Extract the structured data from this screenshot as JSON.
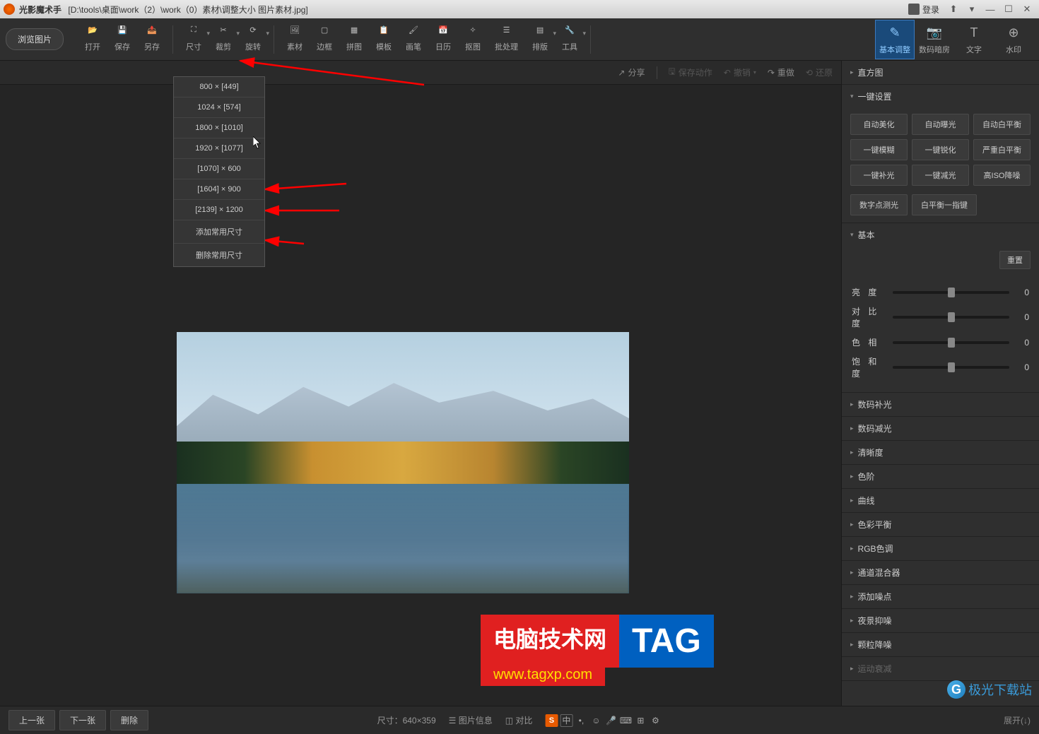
{
  "titlebar": {
    "app_name": "光影魔术手",
    "file_path": "[D:\\tools\\桌面\\work（2）\\work（0）素材\\调整大小 图片素材.jpg]",
    "login": "登录"
  },
  "toolbar": {
    "browse": "浏览图片",
    "items": [
      {
        "label": "打开",
        "icon": "open"
      },
      {
        "label": "保存",
        "icon": "save"
      },
      {
        "label": "另存",
        "icon": "saveas"
      },
      {
        "label": "尺寸",
        "icon": "size",
        "arrow": true
      },
      {
        "label": "裁剪",
        "icon": "crop",
        "arrow": true
      },
      {
        "label": "旋转",
        "icon": "rotate",
        "arrow": true
      },
      {
        "label": "素材",
        "icon": "material"
      },
      {
        "label": "边框",
        "icon": "border"
      },
      {
        "label": "拼图",
        "icon": "collage"
      },
      {
        "label": "模板",
        "icon": "template"
      },
      {
        "label": "画笔",
        "icon": "brush"
      },
      {
        "label": "日历",
        "icon": "calendar"
      },
      {
        "label": "抠图",
        "icon": "cutout"
      },
      {
        "label": "批处理",
        "icon": "batch"
      },
      {
        "label": "排版",
        "icon": "layout",
        "arrow": true
      },
      {
        "label": "工具",
        "icon": "tools",
        "arrow": true
      }
    ]
  },
  "right_tabs": [
    {
      "label": "基本调整",
      "active": true
    },
    {
      "label": "数码暗房",
      "active": false
    },
    {
      "label": "文字",
      "active": false
    },
    {
      "label": "水印",
      "active": false
    }
  ],
  "action_bar": {
    "share": "分享",
    "save_action": "保存动作",
    "undo": "撤销",
    "redo": "重做",
    "restore": "还原"
  },
  "dropdown": {
    "items": [
      "800 × [449]",
      "1024 × [574]",
      "1800 × [1010]",
      "1920 × [1077]",
      "[1070] × 600",
      "[1604] × 900",
      "[2139] × 1200",
      "添加常用尺寸",
      "删除常用尺寸"
    ]
  },
  "right_panel": {
    "sections": {
      "histogram": "直方图",
      "oneclick": "一键设置",
      "basic": "基本",
      "digital_fill": "数码补光",
      "digital_dim": "数码减光",
      "clarity": "清晰度",
      "levels": "色阶",
      "curves": "曲线",
      "color_balance": "色彩平衡",
      "rgb": "RGB色调",
      "channel_mix": "通道混合器",
      "add_noise": "添加噪点",
      "night_suppress": "夜景抑噪",
      "grain_reduce": "颗粒降噪",
      "motion_attenuation": "运动衰减"
    },
    "oneclick_btns": [
      "自动美化",
      "自动曝光",
      "自动白平衡",
      "一键模糊",
      "一键锐化",
      "严重白平衡",
      "一键补光",
      "一键减光",
      "高ISO降噪"
    ],
    "oneclick_row2": [
      "数字点测光",
      "白平衡一指键"
    ],
    "reset": "重置",
    "sliders": [
      {
        "label": "亮  度",
        "value": "0"
      },
      {
        "label": "对 比 度",
        "value": "0"
      },
      {
        "label": "色  相",
        "value": "0"
      },
      {
        "label": "饱 和 度",
        "value": "0"
      }
    ]
  },
  "bottom_bar": {
    "prev": "上一张",
    "next": "下一张",
    "delete": "删除",
    "size_label": "尺寸：",
    "size_value": "640×359",
    "info": "图片信息",
    "compare": "对比",
    "expand": "展开(↓)",
    "ime_zhong": "中"
  },
  "watermark": {
    "text1": "电脑技术网",
    "text2": "TAG",
    "url": "www.tagxp.com",
    "site2": "极光下载站"
  }
}
